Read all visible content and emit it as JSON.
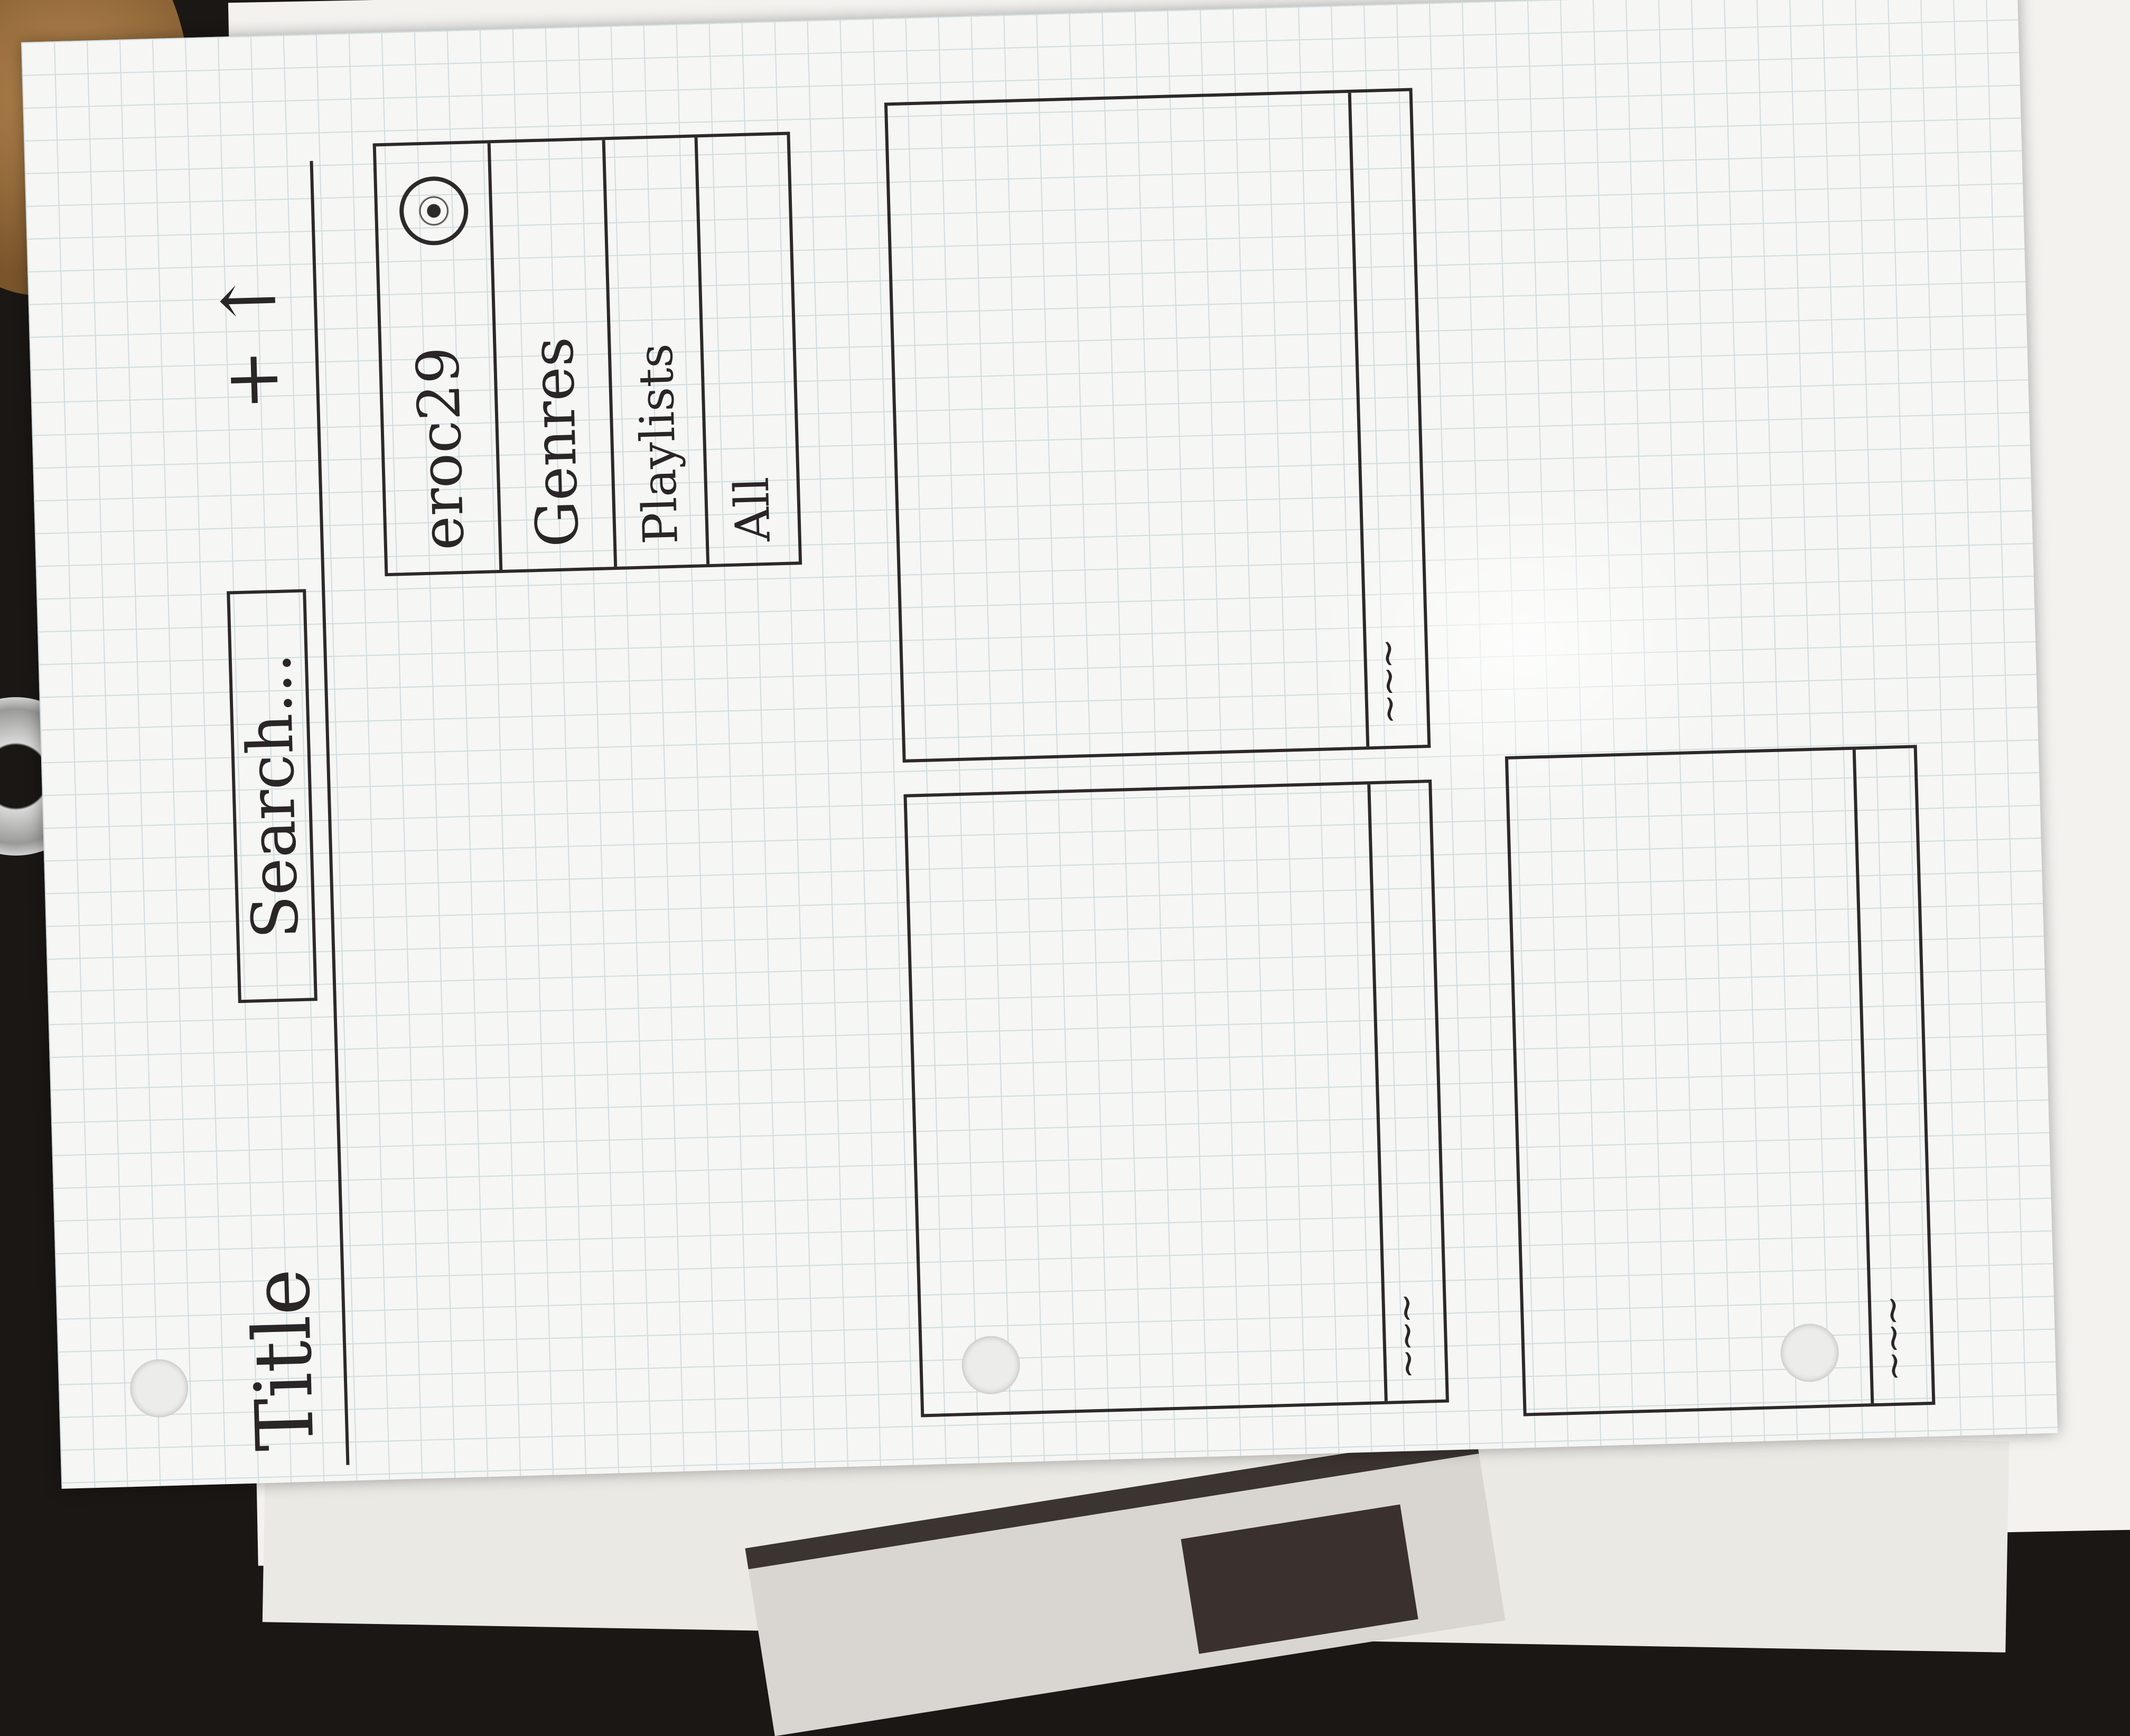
{
  "header": {
    "title": "Title",
    "search_text": "Search...",
    "add_icon": "plus-icon",
    "upload_icon": "up-arrow-icon"
  },
  "profile_menu": {
    "username": "eroc29",
    "avatar_icon": "profile-avatar-icon",
    "items": [
      {
        "label": "Genres"
      },
      {
        "label": "Playlists"
      },
      {
        "label": "All"
      }
    ]
  },
  "cards": [
    {
      "caption": "~~~"
    },
    {
      "caption": "~~~"
    },
    {
      "caption": "~~~"
    }
  ]
}
